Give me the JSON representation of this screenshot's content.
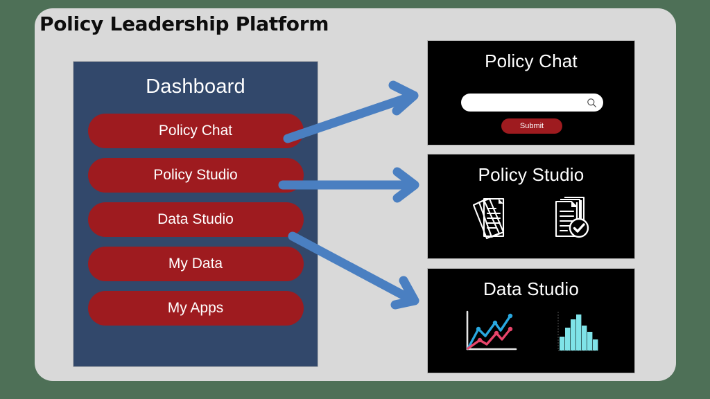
{
  "page": {
    "background_color": "#4e7057",
    "card_color": "#d9d9d9",
    "title": "Policy Leadership Platform"
  },
  "sidebar": {
    "title": "Dashboard",
    "background_color": "#32486b",
    "item_color": "#9e1b1f",
    "items": [
      {
        "label": "Policy Chat"
      },
      {
        "label": "Policy Studio"
      },
      {
        "label": "Data Studio"
      },
      {
        "label": "My Data"
      },
      {
        "label": "My Apps"
      }
    ]
  },
  "panels": {
    "chat": {
      "title": "Policy Chat",
      "search_value": "",
      "search_placeholder": "",
      "search_icon": "search-icon",
      "submit_label": "Submit"
    },
    "studio": {
      "title": "Policy Studio",
      "icons": [
        {
          "name": "document-stack-icon"
        },
        {
          "name": "document-approved-check-icon"
        }
      ]
    },
    "data": {
      "title": "Data Studio",
      "icons": [
        {
          "name": "line-chart-icon"
        },
        {
          "name": "bar-chart-icon"
        }
      ]
    }
  },
  "arrows": {
    "color": "#4a7fc1",
    "items": [
      {
        "name": "arrow-policy-chat"
      },
      {
        "name": "arrow-policy-studio"
      },
      {
        "name": "arrow-data-studio"
      }
    ]
  },
  "chart_data": [
    {
      "type": "line",
      "title": "",
      "xlabel": "",
      "ylabel": "",
      "x": [
        0,
        1,
        2,
        3,
        4,
        5,
        6,
        7
      ],
      "series": [
        {
          "name": "blue-line",
          "color": "#29a8e0",
          "values": [
            0,
            2.0,
            1.4,
            3.0,
            2.5,
            4.0,
            3.3,
            5.0
          ]
        },
        {
          "name": "pink-line",
          "color": "#e8456b",
          "values": [
            0,
            1.0,
            0.6,
            1.7,
            1.3,
            2.5,
            1.8,
            2.6
          ]
        }
      ],
      "grid": false,
      "legend": "none"
    },
    {
      "type": "bar",
      "title": "",
      "xlabel": "",
      "ylabel": "",
      "categories": [
        "1",
        "2",
        "3",
        "4",
        "5",
        "6",
        "7"
      ],
      "values": [
        2.0,
        3.3,
        4.6,
        5.4,
        3.7,
        2.8,
        1.7
      ],
      "color": "#7fe3e8",
      "ylim": [
        0,
        6
      ],
      "grid": false,
      "legend": "none"
    }
  ]
}
